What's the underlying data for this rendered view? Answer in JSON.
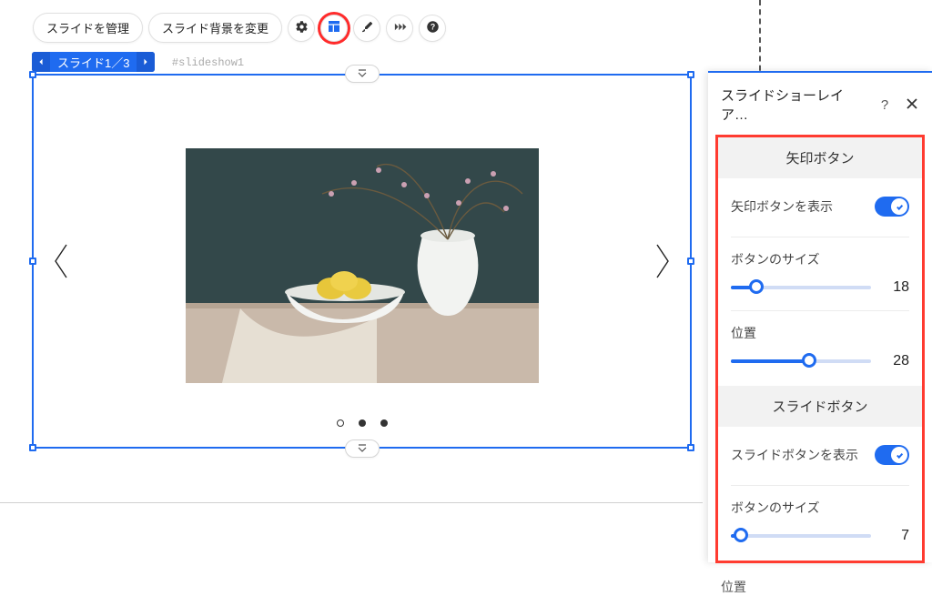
{
  "toolbar": {
    "manageSlides": "スライドを管理",
    "changeBackground": "スライド背景を変更"
  },
  "selection": {
    "label": "スライド1／3",
    "id": "#slideshow1"
  },
  "panel": {
    "title": "スライドショーレイア…",
    "sections": {
      "arrows": {
        "heading": "矢印ボタン",
        "showLabel": "矢印ボタンを表示",
        "showOn": true,
        "sizeLabel": "ボタンのサイズ",
        "sizeValue": 18,
        "sizeMax": 100,
        "positionLabel": "位置",
        "positionValue": 28,
        "positionMax": 50
      },
      "slideButtons": {
        "heading": "スライドボタン",
        "showLabel": "スライドボタンを表示",
        "showOn": true,
        "sizeLabel": "ボタンのサイズ",
        "sizeValue": 7,
        "sizeMax": 100
      },
      "nextTruncated": "位置"
    }
  }
}
